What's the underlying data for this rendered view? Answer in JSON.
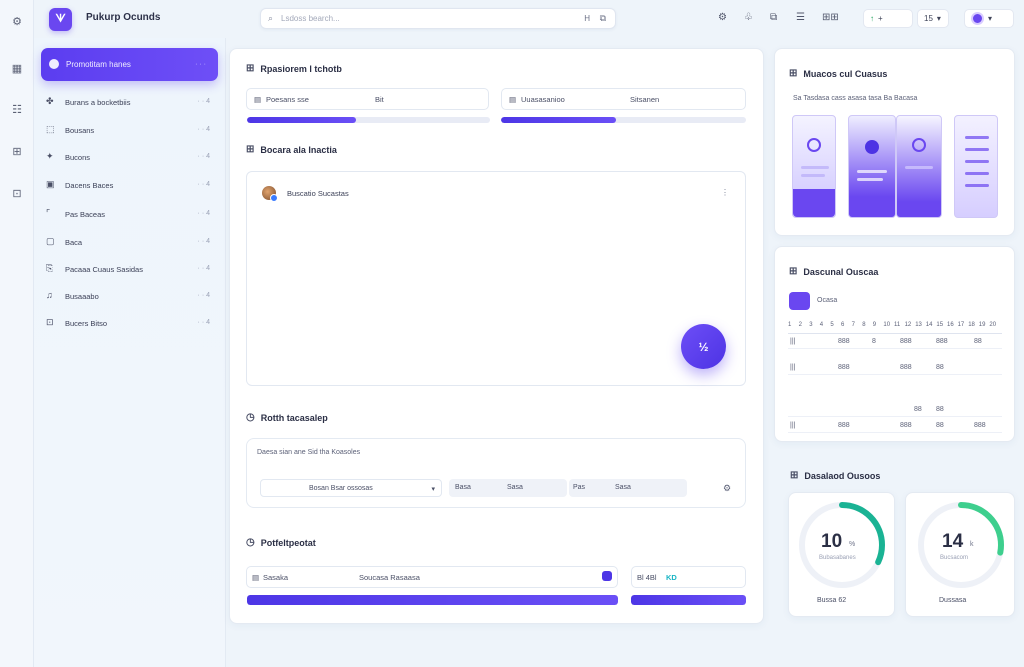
{
  "topbar": {
    "logo_glyph": "ᗐ",
    "title": "Pukurp Ocunds",
    "search_placeholder": "Lsdoss bearch...",
    "search_shortcut": "H",
    "filter_glyph": "⧉",
    "pill1_label": "↑",
    "pill1_value": "+",
    "pill2_label": "15",
    "pill2_suffix": "▾"
  },
  "rail": {
    "icons": [
      "settings-icon",
      "grid-icon",
      "users-icon",
      "layout-icon",
      "window-icon"
    ]
  },
  "sidebar": {
    "active": {
      "label": "Promotitam hanes",
      "meta": "· · ·"
    },
    "items": [
      {
        "icon": "sparkle-icon",
        "label": "Burans a bocketbiis",
        "count": "· · 4"
      },
      {
        "icon": "box-icon",
        "label": "Bousans",
        "count": "· · 4"
      },
      {
        "icon": "star-icon",
        "label": "Bucons",
        "count": "· · 4"
      },
      {
        "icon": "calendar-icon",
        "label": "Dacens Baces",
        "count": "· · 4"
      },
      {
        "icon": "frame-icon",
        "label": "Pas Baceas",
        "count": "· · 4"
      },
      {
        "icon": "square-icon",
        "label": "Baca",
        "count": "· · 4"
      },
      {
        "icon": "doc-icon",
        "label": "Pacaaa Cuaus Sasidas",
        "count": "· · 4"
      },
      {
        "icon": "music-icon",
        "label": "Busaaabo",
        "count": "· · 4"
      },
      {
        "icon": "image-icon",
        "label": "Bucers Bitso",
        "count": "· · 4"
      }
    ]
  },
  "section1": {
    "title": "Rpasiorem l tchotb",
    "field1_a": "Poesans sse",
    "field1_b": "Bit",
    "field2_a": "Uuasasanioo",
    "field2_b": "Sitsanen",
    "progress1": 0.45,
    "progress2": 0.47
  },
  "section2": {
    "title": "Bocara ala Inactia",
    "chat_name": "Buscatio Sucastas",
    "chat_more": "⋮",
    "fab_label": "½"
  },
  "section3": {
    "title": "Rotth tacasalep",
    "subtitle": "Daesa sian ane  Sid tha Koasoles",
    "select_value": "Bosan Bsar ossosas",
    "ctrl1_a": "Basa",
    "ctrl1_b": "Sasa",
    "ctrl2_a": "Pas",
    "ctrl2_b": "Sasa",
    "settings_glyph": "⚙"
  },
  "section4": {
    "title": "Potfeltpeotat",
    "field_a": "Sasaka",
    "field_b": "Soucasa Rasaasa",
    "tag": "Bl 4Bl",
    "tag_accent": "KD",
    "progress1": 1.0,
    "progress2": 1.0
  },
  "right1": {
    "title": "Muacos cul Cuasus",
    "subtitle": "Sa Tasdasa cass asasa tasa Ba Bacasa"
  },
  "right2": {
    "title": "Dascunal Ouscaa",
    "chip": "Ocasa",
    "header": [
      "1",
      "2",
      "3",
      "4",
      "5",
      "6",
      "7",
      "8",
      "9",
      "10",
      "11",
      "12",
      "13",
      "14",
      "15",
      "16",
      "17",
      "18",
      "19",
      "20"
    ],
    "rows": [
      [
        "|||",
        "888",
        "8",
        "888",
        "888",
        "88"
      ],
      [
        "|||",
        "888",
        "",
        "888",
        "88",
        ""
      ],
      [
        "",
        "",
        "",
        "88",
        "88",
        ""
      ],
      [
        "|||",
        "888",
        "",
        "888",
        "88",
        "888"
      ]
    ]
  },
  "right3": {
    "title": "Dasalaod Ousoos",
    "gauge1": {
      "value": "10",
      "unit": "%",
      "sub": "Bubasabanes",
      "foot": "Bussa 62",
      "fraction": 0.32,
      "color": "#1ab394"
    },
    "gauge2": {
      "value": "14",
      "unit": "k",
      "sub": "Bucsacom",
      "foot": "Dussasa",
      "fraction": 0.28,
      "color": "#3ecf8e"
    }
  },
  "colors": {
    "accent": "#6a47f0",
    "accent_dark": "#4d33e4",
    "teal": "#1ab394"
  }
}
